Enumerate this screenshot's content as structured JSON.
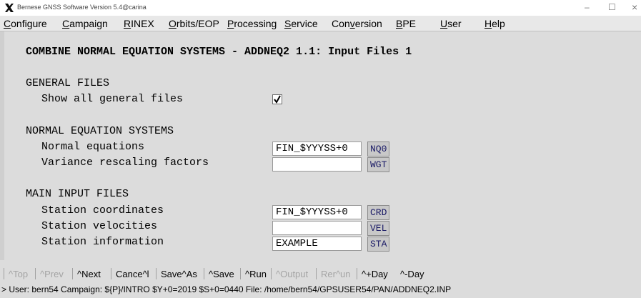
{
  "window": {
    "title": "Bernese GNSS Software Version 5.4@carina",
    "minimize_glyph": "–",
    "maximize_glyph": "☐",
    "close_glyph": "×",
    "logo_icon": "x-logo-icon"
  },
  "menu": [
    {
      "pre": "",
      "mnemonic": "C",
      "post": "onfigure"
    },
    {
      "pre": "",
      "mnemonic": "C",
      "post": "ampaign"
    },
    {
      "pre": "",
      "mnemonic": "R",
      "post": "INEX"
    },
    {
      "pre": "",
      "mnemonic": "O",
      "post": "rbits/EOP"
    },
    {
      "pre": "",
      "mnemonic": "P",
      "post": "rocessing"
    },
    {
      "pre": "",
      "mnemonic": "S",
      "post": "ervice"
    },
    {
      "pre": "Con",
      "mnemonic": "v",
      "post": "ersion"
    },
    {
      "pre": "",
      "mnemonic": "B",
      "post": "PE"
    },
    {
      "pre": "",
      "mnemonic": "U",
      "post": "ser"
    },
    {
      "pre": "",
      "mnemonic": "H",
      "post": "elp"
    }
  ],
  "panel": {
    "title": "COMBINE NORMAL EQUATION SYSTEMS - ADDNEQ2 1.1: Input Files 1",
    "general": {
      "heading": "GENERAL FILES",
      "show_all_label": "Show all general files",
      "show_all_checked": true
    },
    "neq": {
      "heading": "NORMAL EQUATION SYSTEMS",
      "normal_eq_label": "Normal equations",
      "normal_eq_value": "FIN_$YYYSS+0",
      "normal_eq_btn": "NQ0",
      "variance_label": "Variance rescaling factors",
      "variance_value": "",
      "variance_btn": "WGT"
    },
    "main": {
      "heading": "MAIN INPUT FILES",
      "coord_label": "Station coordinates",
      "coord_value": "FIN_$YYYSS+0",
      "coord_btn": "CRD",
      "vel_label": "Station velocities",
      "vel_value": "",
      "vel_btn": "VEL",
      "info_label": "Station information",
      "info_value": "EXAMPLE",
      "info_btn": "STA"
    }
  },
  "toolbar": [
    {
      "label": "^Top",
      "enabled": false
    },
    {
      "label": "^Prev",
      "enabled": false
    },
    {
      "label": "^Next",
      "enabled": true
    },
    {
      "label": "Cance^l",
      "enabled": true
    },
    {
      "label": "Save^As",
      "enabled": true
    },
    {
      "label": "^Save",
      "enabled": true
    },
    {
      "label": "^Run",
      "enabled": true
    },
    {
      "label": "^Output",
      "enabled": false
    },
    {
      "label": "Rer^un",
      "enabled": false
    },
    {
      "label": "^+Day",
      "enabled": true
    },
    {
      "label": "^-Day",
      "enabled": true
    }
  ],
  "status": "> User: bern54  Campaign: ${P}/INTRO  $Y+0=2019  $S+0=0440  File: /home/bern54/GPSUSER54/PAN/ADDNEQ2.INP"
}
